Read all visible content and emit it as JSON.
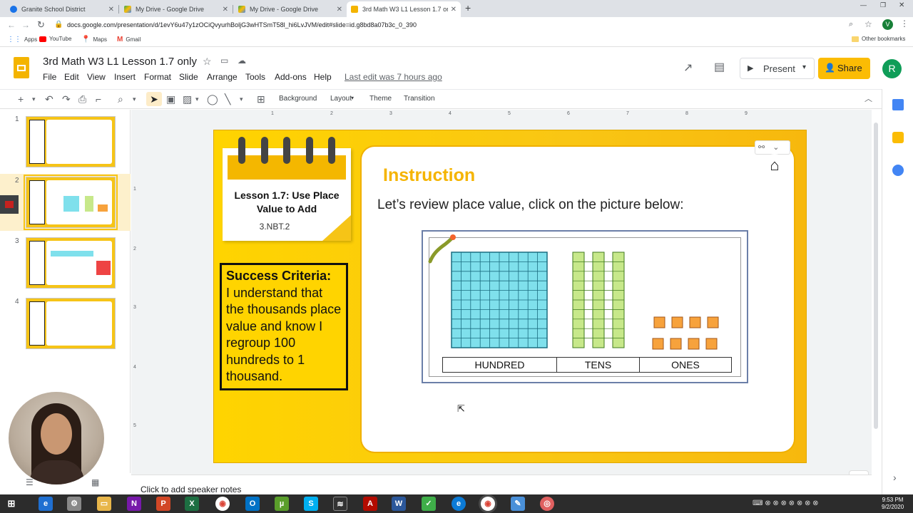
{
  "browser": {
    "tabs": [
      {
        "title": "Granite School District",
        "favicon_color": "#1a73e8"
      },
      {
        "title": "My Drive - Google Drive",
        "favicon_color": "#34a853"
      },
      {
        "title": "My Drive - Google Drive",
        "favicon_color": "#34a853"
      },
      {
        "title": "3rd Math W3 L1 Lesson 1.7 only",
        "favicon_color": "#f4b400",
        "active": true
      }
    ],
    "new_tab_label": "+",
    "url": "docs.google.com/presentation/d/1evY6u47y1zOCiQvyurhBoljG3wHTSmT58l_hi6LvJVM/edit#slide=id.g8bd8a07b3c_0_390",
    "profile_initial": "V",
    "bookmarks": [
      {
        "label": "Apps",
        "icon": "apps-grid-icon"
      },
      {
        "label": "YouTube",
        "icon": "youtube-icon"
      },
      {
        "label": "Maps",
        "icon": "maps-icon"
      },
      {
        "label": "Gmail",
        "icon": "gmail-icon"
      }
    ],
    "other_bookmarks": "Other bookmarks"
  },
  "docs": {
    "title": "3rd Math W3 L1 Lesson 1.7 only",
    "menu": [
      "File",
      "Edit",
      "View",
      "Insert",
      "Format",
      "Slide",
      "Arrange",
      "Tools",
      "Add-ons",
      "Help"
    ],
    "last_edit": "Last edit was 7 hours ago",
    "present_label": "Present",
    "share_label": "Share",
    "avatar_initial": "R",
    "toolbar_text_buttons": [
      "Background",
      "Layout",
      "Theme",
      "Transition"
    ]
  },
  "filmstrip": {
    "slides": [
      "1",
      "2",
      "3",
      "4"
    ],
    "selected": "2"
  },
  "ruler": {
    "marks": [
      "1",
      "2",
      "3",
      "4",
      "5",
      "6",
      "7",
      "8",
      "9"
    ],
    "vmarks": [
      "1",
      "2",
      "3",
      "4",
      "5"
    ]
  },
  "slide": {
    "lesson_title": "Lesson 1.7: Use Place Value to Add",
    "standard": "3.NBT.2",
    "success_heading": "Success Criteria:",
    "success_text": "I understand that the thousands place value and know I regroup 100 hundreds to 1 thousand.",
    "instruction_heading": "Instruction",
    "instruction_text": "Let’s review place value, click on the picture below:",
    "place_value_labels": [
      "HUNDRED",
      "TENS",
      "ONES"
    ]
  },
  "notes": {
    "placeholder": "Click to add speaker notes"
  },
  "taskbar": {
    "time": "9:53 PM",
    "date": "9/2/2020"
  },
  "colors": {
    "slide_yellow": "#ffd400",
    "instruction_orange": "#f5b400",
    "hundreds_blue": "#7fe0ec",
    "tens_green": "#c7e88a",
    "ones_orange": "#f7a23c",
    "share_yellow": "#fbbc04"
  }
}
